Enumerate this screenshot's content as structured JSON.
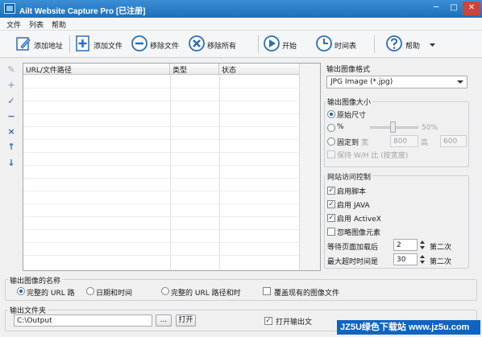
{
  "window": {
    "title": "Ailt Website Capture Pro [已注册]",
    "min": "─",
    "max": "□",
    "close": "✕"
  },
  "menu": [
    "文件",
    "列表",
    "帮助"
  ],
  "toolbar": {
    "add_address": "添加地址",
    "add_file": "添加文件",
    "remove_file": "移除文件",
    "remove_all": "移除所有",
    "start": "开始",
    "schedule": "时间表",
    "help": "帮助"
  },
  "lefttools": [
    "✎",
    "+",
    "✓",
    "−",
    "×",
    "↑",
    "↓"
  ],
  "grid": {
    "columns": [
      "URL/文件路径",
      "类型",
      "状态"
    ]
  },
  "output_format": {
    "title": "输出图像格式",
    "value": "JPG Image (*.jpg)"
  },
  "output_size": {
    "title": "输出图像大小",
    "original": "原始尺寸",
    "percent": "%",
    "percent_value": "50%",
    "fixed": "固定到",
    "width_label": "宽",
    "width": "800",
    "height_label": "高",
    "height": "600",
    "keep_ratio": "保持 W/H 比 (按宽度)"
  },
  "access": {
    "title": "网站访问控制",
    "script": "启用脚本",
    "java": "启用 JAVA",
    "activex": "启用 ActiveX",
    "ignore_images": "忽略图像元素",
    "wait_label": "等待页面加载后",
    "wait_value": "2",
    "wait_unit": "第二次",
    "timeout_label": "最大超时时间是",
    "timeout_value": "30",
    "timeout_unit": "第二次"
  },
  "naming": {
    "title": "输出图像的名称",
    "full_url": "完整的 URL 路",
    "datetime": "日期和时间",
    "full_url_time": "完整的 URL 路径和时",
    "overwrite": "覆盖现有的图像文件"
  },
  "output_folder": {
    "title": "输出文件夹",
    "path": "C:\\Output",
    "browse": "...",
    "open": "打开",
    "open_after": "打开输出文"
  },
  "watermark": "JZ5U绿色下载站 www.jz5u.com"
}
